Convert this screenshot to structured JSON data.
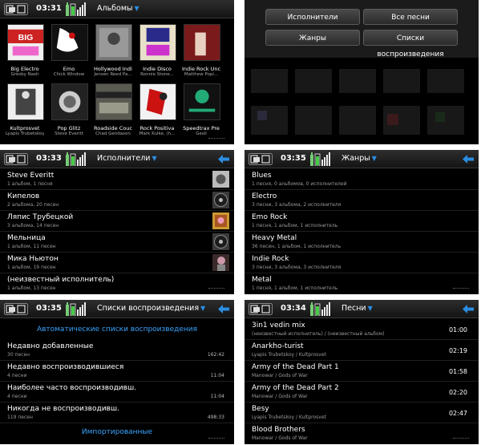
{
  "screens": [
    {
      "time": "03:31",
      "title": "Альбомы",
      "albums": [
        {
          "title": "Big Electro",
          "artist": "Gresby Nash"
        },
        {
          "title": "Emo",
          "artist": "Chick Window"
        },
        {
          "title": "Hollywood Indie",
          "artist": "Jensen Reed Pa..."
        },
        {
          "title": "Indie Disco",
          "artist": "Ronnie Stone..."
        },
        {
          "title": "Indie Rock Uncut",
          "artist": "Matthew Popi..."
        },
        {
          "title": "Kultprosvet",
          "artist": "Lyapis Trubetskoy"
        },
        {
          "title": "Pop Glitz",
          "artist": "Steve Everitt"
        },
        {
          "title": "Roadside Couch",
          "artist": "Chad Gendason"
        },
        {
          "title": "Rock Positiva",
          "artist": "Mark Kulke, (h..."
        },
        {
          "title": "Speedtrax Pre",
          "artist": "Gesli"
        }
      ]
    },
    {
      "menu": [
        "Исполнители",
        "Все песни",
        "Жанры",
        "Списки воспроизведения"
      ]
    },
    {
      "time": "03:33",
      "title": "Исполнители",
      "rows": [
        {
          "name": "Steve Everitt",
          "sub": "1 альбом, 1 песня"
        },
        {
          "name": "Кипелов",
          "sub": "2 альбома, 20 песен"
        },
        {
          "name": "Ляпис Трубецкой",
          "sub": "3 альбома, 14 песен"
        },
        {
          "name": "Мельница",
          "sub": "1 альбом, 11 песен"
        },
        {
          "name": "Мика Ньютон",
          "sub": "1 альбом, 19 песен"
        },
        {
          "name": "(неизвестный исполнитель)",
          "sub": "1 альбом, 13 песен"
        }
      ]
    },
    {
      "time": "03:35",
      "title": "Жанры",
      "rows": [
        {
          "name": "Blues",
          "sub": "1 песня, 0 альбомов, 0 исполнителей"
        },
        {
          "name": "Electro",
          "sub": "3 песни, 3 альбома, 2 исполнителя"
        },
        {
          "name": "Emo Rock",
          "sub": "1 песня, 1 альбом, 1 исполнитель"
        },
        {
          "name": "Heavy Metal",
          "sub": "36 песен, 1 альбом, 1 исполнитель"
        },
        {
          "name": "Indie Rock",
          "sub": "3 песни, 3 альбома, 3 исполнителя"
        },
        {
          "name": "Metal",
          "sub": "1 песня, 1 альбом, 1 исполнитель"
        }
      ]
    },
    {
      "time": "03:35",
      "title": "Списки воспроизведения",
      "header_auto": "Автоматические списки воспроизведения",
      "rows": [
        {
          "name": "Недавно добавленные",
          "sub": "30 песен",
          "dur": "162:42"
        },
        {
          "name": "Недавно воспроизводившиеся",
          "sub": "4 песни",
          "dur": "11:04"
        },
        {
          "name": "Наиболее часто воспроизводивш.",
          "sub": "4 песни",
          "dur": "11:04"
        },
        {
          "name": "Никогда не воспроизводивш.",
          "sub": "119 песен",
          "dur": "498:33"
        }
      ],
      "header_imported": "Импортированные"
    },
    {
      "time": "03:34",
      "title": "Песни",
      "rows": [
        {
          "name": "3in1 vedin mix",
          "sub": "(неизвестный исполнитель) / (неизвестный альбом)",
          "dur": "01:00"
        },
        {
          "name": "Anarkho-turist",
          "sub": "Lyapis Trubetskoy / Kultprosvet",
          "dur": "02:19"
        },
        {
          "name": "Army of the Dead Part 1",
          "sub": "Manowar / Gods of War",
          "dur": "01:58"
        },
        {
          "name": "Army of the Dead Part 2",
          "sub": "Manowar / Gods of War",
          "dur": "02:20"
        },
        {
          "name": "Besy",
          "sub": "Lyapis Trubetskoy / Kultprosvet",
          "dur": "02:47"
        },
        {
          "name": "Blood Brothers",
          "sub": "Manowar / Gods of War",
          "dur": ""
        }
      ]
    }
  ]
}
